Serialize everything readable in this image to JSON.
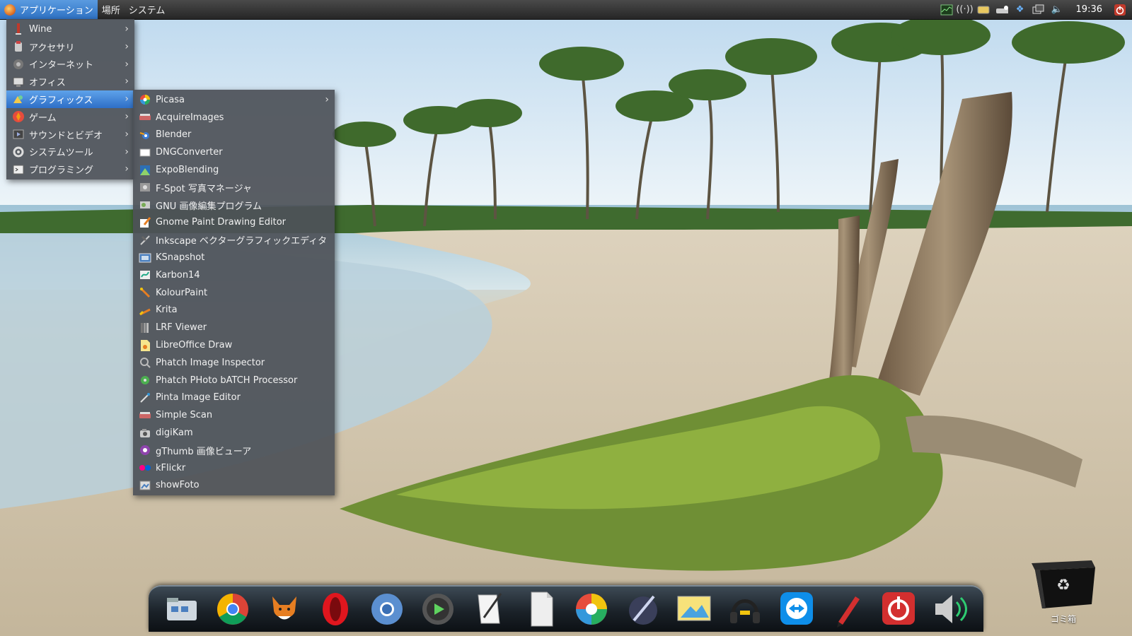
{
  "top_panel": {
    "applications_label": "アプリケーション",
    "places_label": "場所",
    "system_label": "システム",
    "clock": "19:36"
  },
  "main_menu": {
    "items": [
      {
        "label": "Wine",
        "icon": "wine-icon"
      },
      {
        "label": "アクセサリ",
        "icon": "accessories-icon"
      },
      {
        "label": "インターネット",
        "icon": "internet-icon"
      },
      {
        "label": "オフィス",
        "icon": "office-icon"
      },
      {
        "label": "グラフィックス",
        "icon": "graphics-icon",
        "highlighted": true
      },
      {
        "label": "ゲーム",
        "icon": "games-icon"
      },
      {
        "label": "サウンドとビデオ",
        "icon": "sound-video-icon"
      },
      {
        "label": "システムツール",
        "icon": "system-tools-icon"
      },
      {
        "label": "プログラミング",
        "icon": "programming-icon"
      }
    ]
  },
  "graphics_menu": {
    "items": [
      {
        "label": "Picasa",
        "icon": "picasa-icon",
        "has_submenu": true
      },
      {
        "label": "AcquireImages",
        "icon": "scanner-icon"
      },
      {
        "label": "Blender",
        "icon": "blender-icon"
      },
      {
        "label": "DNGConverter",
        "icon": "dng-icon"
      },
      {
        "label": "ExpoBlending",
        "icon": "expoblending-icon"
      },
      {
        "label": "F-Spot 写真マネージャ",
        "icon": "fspot-icon"
      },
      {
        "label": "GNU 画像編集プログラム",
        "icon": "gimp-icon"
      },
      {
        "label": "Gnome Paint Drawing Editor",
        "icon": "gnome-paint-icon"
      },
      {
        "label": "Inkscape ベクターグラフィックエディタ",
        "icon": "inkscape-icon"
      },
      {
        "label": "KSnapshot",
        "icon": "ksnapshot-icon"
      },
      {
        "label": "Karbon14",
        "icon": "karbon-icon"
      },
      {
        "label": "KolourPaint",
        "icon": "kolourpaint-icon"
      },
      {
        "label": "Krita",
        "icon": "krita-icon"
      },
      {
        "label": "LRF Viewer",
        "icon": "lrf-icon"
      },
      {
        "label": "LibreOffice Draw",
        "icon": "libreoffice-draw-icon"
      },
      {
        "label": "Phatch Image Inspector",
        "icon": "phatch-inspector-icon"
      },
      {
        "label": "Phatch PHoto bATCH Processor",
        "icon": "phatch-icon"
      },
      {
        "label": "Pinta Image Editor",
        "icon": "pinta-icon"
      },
      {
        "label": "Simple Scan",
        "icon": "scan-icon"
      },
      {
        "label": "digiKam",
        "icon": "digikam-icon"
      },
      {
        "label": "gThumb 画像ビューア",
        "icon": "gthumb-icon"
      },
      {
        "label": "kFlickr",
        "icon": "kflickr-icon"
      },
      {
        "label": "showFoto",
        "icon": "showfoto-icon"
      }
    ]
  },
  "dock": {
    "items": [
      "file-manager-icon",
      "chrome-icon",
      "fox-icon",
      "opera-icon",
      "chromium-icon",
      "media-player-icon",
      "text-editor-icon",
      "blank-document-icon",
      "picasa-icon",
      "inkscape-pen-icon",
      "image-viewer-icon",
      "headphones-icon",
      "teamviewer-icon",
      "marker-icon",
      "power-icon",
      "volume-icon"
    ]
  },
  "trash": {
    "label": "ゴミ箱"
  },
  "colors": {
    "highlight": "#2e6fc7",
    "menu_bg": "#4e5258",
    "panel_bg": "#262626"
  }
}
